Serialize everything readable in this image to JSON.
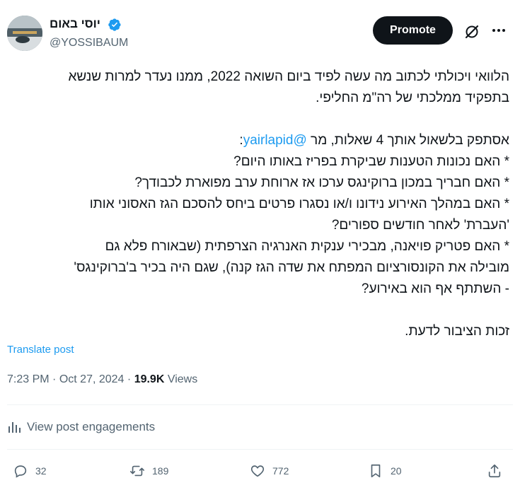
{
  "author": {
    "display_name": "יוסי באום",
    "handle": "@YOSSIBAUM"
  },
  "header": {
    "promote_label": "Promote"
  },
  "tweet": {
    "line1": "הלוואי ויכולתי לכתוב מה עשה לפיד ביום השואה 2022, ממנו נעדר למרות שנשא",
    "line2": "בתפקיד ממלכתי של רה\"מ החליפי.",
    "line3_prefix": "אסתפק בלשאול אותך 4 שאלות, מר ",
    "mention": "@yairlapid",
    "line3_suffix": ":",
    "line4": "* האם נכונות הטענות שביקרת בפריז באותו היום?",
    "line5": "* האם חבריך במכון ברוקינגס ערכו אז ארוחת ערב מפוארת לכבודך?",
    "line6": "* האם במהלך האירוע נידונו ו/או נסגרו פרטים ביחס להסכם הגז האסוני אותו",
    "line7": "'העברת' לאחר חודשים ספורים?",
    "line8": "* האם פטריק פויאנה, מבכירי ענקית האנרגיה הצרפתית (שבאורח פלא גם",
    "line9": "מובילה את הקונסורציום המפתח את שדה הגז קנה), שגם היה בכיר ב'ברוקינגס'",
    "line10": "- השתתף אף הוא באירוע?",
    "line11": "זכות הציבור לדעת."
  },
  "translate_label": "Translate post",
  "meta": {
    "time": "7:23 PM",
    "date": "Oct 27, 2024",
    "views_count": "19.9K",
    "views_label": "Views",
    "sep": "·"
  },
  "engagements_label": "View post engagements",
  "actions": {
    "replies": "32",
    "reposts": "189",
    "likes": "772",
    "bookmarks": "20"
  },
  "colors": {
    "accent": "#1d9bf0",
    "text": "#0f1419",
    "muted": "#536471"
  }
}
